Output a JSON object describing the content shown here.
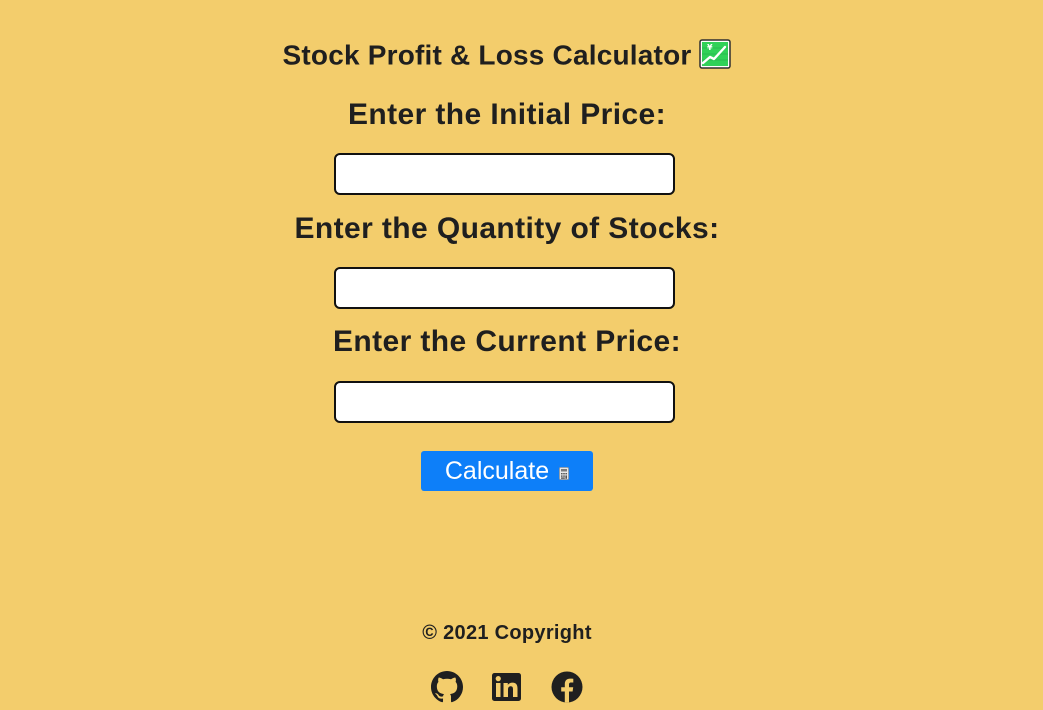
{
  "header": {
    "title": "Stock Profit & Loss Calculator",
    "title_icon": "chart-increasing-with-yen-icon"
  },
  "form": {
    "initial_price_label": "Enter the Initial Price:",
    "initial_price_value": "",
    "quantity_label": "Enter the Quantity of Stocks:",
    "quantity_value": "",
    "current_price_label": "Enter the Current Price:",
    "current_price_value": "",
    "calculate_label": "Calculate",
    "calculate_icon": "calculator-icon"
  },
  "footer": {
    "copyright": "© 2021 Copyright",
    "social_icons": [
      "github-icon",
      "linkedin-icon",
      "facebook-icon"
    ]
  },
  "colors": {
    "background": "#f3cd6c",
    "text": "#1f1f1f",
    "button": "#0d7ff9",
    "button_text": "#ffffff",
    "input_border": "#111111"
  }
}
